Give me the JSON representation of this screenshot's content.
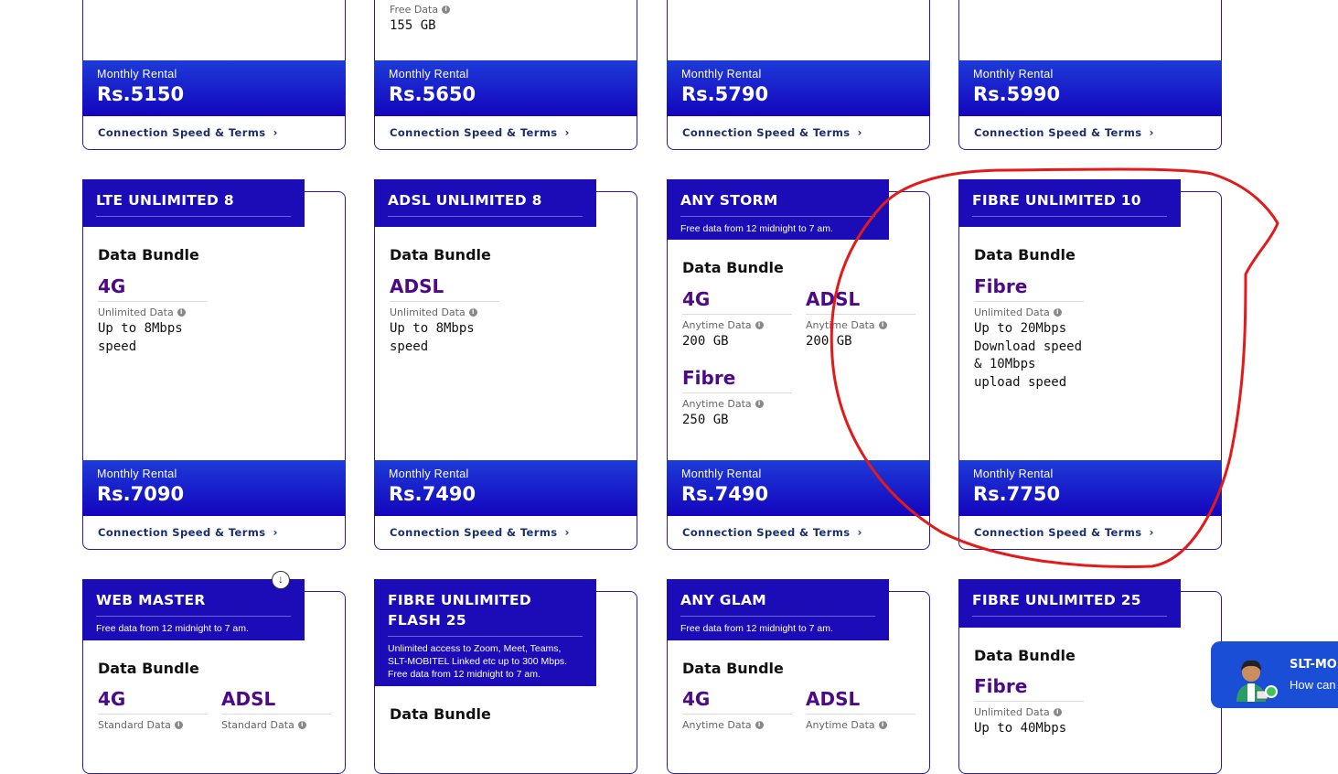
{
  "common": {
    "data_bundle": "Data Bundle",
    "monthly_rental": "Monthly Rental",
    "terms_link": "Connection Speed & Terms",
    "free_night_note": "Free data from 12 midnight to 7 am."
  },
  "row1": [
    {
      "price": "Rs.5150"
    },
    {
      "price": "Rs.5650",
      "partial_label": "Free Data",
      "partial_value": "155 GB"
    },
    {
      "price": "Rs.5790"
    },
    {
      "price": "Rs.5990"
    }
  ],
  "row2": [
    {
      "title": "LTE UNLIMITED 8",
      "price": "Rs.7090",
      "items": [
        {
          "name": "4G",
          "label": "Unlimited Data",
          "value": "Up to 8Mbps speed"
        }
      ]
    },
    {
      "title": "ADSL UNLIMITED 8",
      "price": "Rs.7490",
      "items": [
        {
          "name": "ADSL",
          "label": "Unlimited Data",
          "value": "Up to 8Mbps speed"
        }
      ]
    },
    {
      "title": "ANY STORM",
      "note": "Free data from 12 midnight to 7 am.",
      "price": "Rs.7490",
      "items": [
        {
          "name": "4G",
          "label": "Anytime Data",
          "value": "200 GB"
        },
        {
          "name": "ADSL",
          "label": "Anytime Data",
          "value": "200 GB"
        },
        {
          "name": "Fibre",
          "label": "Anytime Data",
          "value": "250 GB"
        }
      ]
    },
    {
      "title": "FIBRE UNLIMITED 10",
      "price": "Rs.7750",
      "items": [
        {
          "name": "Fibre",
          "label": "Unlimited Data",
          "value": "Up to 20Mbps Download speed & 10Mbps upload speed"
        }
      ]
    }
  ],
  "row3": [
    {
      "title": "WEB MASTER",
      "note": "Free data from 12 midnight to 7 am.",
      "items": [
        {
          "name": "4G",
          "label": "Standard Data"
        },
        {
          "name": "ADSL",
          "label": "Standard Data"
        }
      ]
    },
    {
      "title": "FIBRE UNLIMITED FLASH 25",
      "note": "Unlimited access to Zoom, Meet, Teams, SLT-MOBITEL Linked etc up to 300 Mbps. Free data from 12 midnight to 7 am."
    },
    {
      "title": "ANY GLAM",
      "note": "Free data from 12 midnight to 7 am.",
      "items": [
        {
          "name": "4G",
          "label": "Anytime Data"
        },
        {
          "name": "ADSL",
          "label": "Anytime Data"
        }
      ]
    },
    {
      "title": "FIBRE UNLIMITED 25",
      "items": [
        {
          "name": "Fibre",
          "label": "Unlimited Data",
          "value": "Up to 40Mbps"
        }
      ]
    }
  ],
  "chat_widget": {
    "title": "SLT-MOB",
    "subtitle": "How can"
  },
  "colors": {
    "brand_blue": "#1b0cb8",
    "plan_purple": "#4d0a86",
    "annotation_red": "#e21a1a"
  }
}
